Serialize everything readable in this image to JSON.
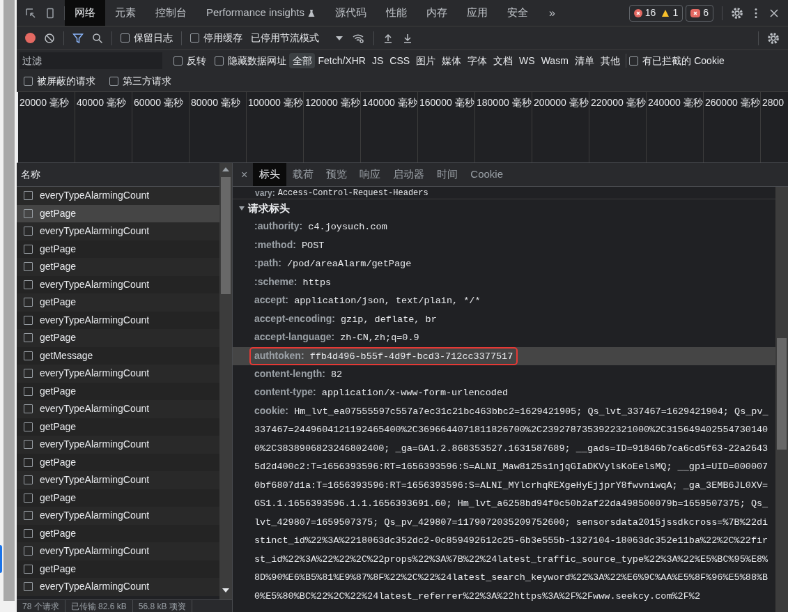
{
  "main_tabs": [
    {
      "label": "网络",
      "selected": true
    },
    {
      "label": "元素",
      "selected": false
    },
    {
      "label": "控制台",
      "selected": false
    },
    {
      "label": "Performance insights",
      "selected": false,
      "flask": true
    },
    {
      "label": "源代码",
      "selected": false
    },
    {
      "label": "性能",
      "selected": false
    },
    {
      "label": "内存",
      "selected": false
    },
    {
      "label": "应用",
      "selected": false
    },
    {
      "label": "安全",
      "selected": false
    }
  ],
  "more_tabs": "»",
  "counters": {
    "errors": "16",
    "warnings": "1",
    "issues": "6"
  },
  "toolbar": {
    "preserve_log": {
      "label": "保留日志",
      "checked": false
    },
    "disable_cache": {
      "label": "停用缓存",
      "checked": false
    },
    "throttling": "已停用节流模式",
    "recording": true
  },
  "filter": {
    "placeholder": "过滤",
    "invert": {
      "label": "反转",
      "checked": false
    },
    "hide_data_urls": {
      "label": "隐藏数据网址",
      "checked": false
    },
    "types": [
      {
        "label": "全部",
        "selected": true
      },
      {
        "label": "Fetch/XHR",
        "selected": false
      },
      {
        "label": "JS",
        "selected": false
      },
      {
        "label": "CSS",
        "selected": false
      },
      {
        "label": "图片",
        "selected": false
      },
      {
        "label": "媒体",
        "selected": false
      },
      {
        "label": "字体",
        "selected": false
      },
      {
        "label": "文档",
        "selected": false
      },
      {
        "label": "WS",
        "selected": false
      },
      {
        "label": "Wasm",
        "selected": false
      },
      {
        "label": "清单",
        "selected": false
      },
      {
        "label": "其他",
        "selected": false
      }
    ],
    "blocked_cookies": {
      "label": "有已拦截的 Cookie",
      "checked": false
    },
    "blocked_requests": {
      "label": "被屏蔽的请求",
      "checked": false
    },
    "third_party": {
      "label": "第三方请求",
      "checked": false
    }
  },
  "timeline": {
    "ticks": [
      "20000 毫秒",
      "40000 毫秒",
      "60000 毫秒",
      "80000 毫秒",
      "100000 毫秒",
      "120000 毫秒",
      "140000 毫秒",
      "160000 毫秒",
      "180000 毫秒",
      "200000 毫秒",
      "220000 毫秒",
      "240000 毫秒",
      "260000 毫秒",
      "2800"
    ]
  },
  "requests": {
    "column": "名称",
    "rows": [
      {
        "name": "everyTypeAlarmingCount",
        "selected": false
      },
      {
        "name": "getPage",
        "selected": true
      },
      {
        "name": "everyTypeAlarmingCount",
        "selected": false
      },
      {
        "name": "getPage",
        "selected": false
      },
      {
        "name": "getPage",
        "selected": false
      },
      {
        "name": "everyTypeAlarmingCount",
        "selected": false
      },
      {
        "name": "getPage",
        "selected": false
      },
      {
        "name": "everyTypeAlarmingCount",
        "selected": false
      },
      {
        "name": "getPage",
        "selected": false
      },
      {
        "name": "getMessage",
        "selected": false
      },
      {
        "name": "everyTypeAlarmingCount",
        "selected": false
      },
      {
        "name": "getPage",
        "selected": false
      },
      {
        "name": "everyTypeAlarmingCount",
        "selected": false
      },
      {
        "name": "getPage",
        "selected": false
      },
      {
        "name": "everyTypeAlarmingCount",
        "selected": false
      },
      {
        "name": "getPage",
        "selected": false
      },
      {
        "name": "everyTypeAlarmingCount",
        "selected": false
      },
      {
        "name": "getPage",
        "selected": false
      },
      {
        "name": "everyTypeAlarmingCount",
        "selected": false
      },
      {
        "name": "getPage",
        "selected": false
      },
      {
        "name": "everyTypeAlarmingCount",
        "selected": false
      },
      {
        "name": "getPage",
        "selected": false
      },
      {
        "name": "everyTypeAlarmingCount",
        "selected": false
      }
    ]
  },
  "status_bar": [
    "78 个请求",
    "已传输 82.6 kB",
    "56.8 kB 项资"
  ],
  "detail_tabs": {
    "close": "×",
    "tabs": [
      {
        "label": "标头",
        "selected": true
      },
      {
        "label": "载荷",
        "selected": false
      },
      {
        "label": "预览",
        "selected": false
      },
      {
        "label": "响应",
        "selected": false
      },
      {
        "label": "启动器",
        "selected": false
      },
      {
        "label": "时间",
        "selected": false
      },
      {
        "label": "Cookie",
        "selected": false
      }
    ]
  },
  "headers": {
    "partial_row": {
      "name": "vary:",
      "value": "Access-Control-Request-Headers"
    },
    "section": {
      "title": "请求标头",
      "expanded": true
    },
    "rows": [
      {
        "name": ":authority:",
        "value": "c4.joysuch.com",
        "highlighted": false
      },
      {
        "name": ":method:",
        "value": "POST",
        "highlighted": false
      },
      {
        "name": ":path:",
        "value": "/pod/areaAlarm/getPage",
        "highlighted": false
      },
      {
        "name": ":scheme:",
        "value": "https",
        "highlighted": false
      },
      {
        "name": "accept:",
        "value": "application/json, text/plain, */*",
        "highlighted": false
      },
      {
        "name": "accept-encoding:",
        "value": "gzip, deflate, br",
        "highlighted": false
      },
      {
        "name": "accept-language:",
        "value": "zh-CN,zh;q=0.9",
        "highlighted": false
      },
      {
        "name": "authtoken:",
        "value": "ffb4d496-b55f-4d9f-bcd3-712cc3377517",
        "highlighted": true
      },
      {
        "name": "content-length:",
        "value": "82",
        "highlighted": false
      },
      {
        "name": "content-type:",
        "value": "application/x-www-form-urlencoded",
        "highlighted": false
      },
      {
        "name": "cookie:",
        "value": "Hm_lvt_ea07555597c557a7ec31c21bc463bbc2=1629421905; Qs_lvt_337467=1629421904; Qs_pv_337467=2449604121192465400%2C3696644071811826700%2C2392787353922321000%2C3156494025547301400%2C3838906823246802400; _ga=GA1.2.868353527.1631587689; __gads=ID=91846b7ca6cd5f63-22a26435d2d400c2:T=1656393596:RT=1656393596:S=ALNI_Maw8i25s1njqGIaDKVylsKoEelsMQ; __gpi=UID=0000070bf6807d1a:T=1656393596:RT=1656393596:S=ALNI_MYlcrhqREXgeHyEjjprY8fwvniwqA; _ga_3EMB6JL0XV=GS1.1.1656393596.1.1.1656393691.60; Hm_lvt_a6258bd94f0c50b2af22da498500079b=1659507375; Qs_lvt_429807=1659507375; Qs_pv_429807=1179072035209752600; sensorsdata2015jssdkcross=%7B%22distinct_id%22%3A%2218063dc352dc2-0c859492612c25-6b3e555b-1327104-18063dc352e11ba%22%2C%22first_id%22%3A%22%22%2C%22props%22%3A%7B%22%24latest_traffic_source_type%22%3A%22%E5%BC%95%E8%8D%90%E6%B5%81%E9%87%8F%22%2C%22%24latest_search_keyword%22%3A%22%E6%9C%AA%E5%8F%96%E5%88%B0%E5%80%BC%22%2C%22%24latest_referrer%22%3A%22https%3A%2F%2Fwww.seekcy.com%2F%2",
        "highlighted": false
      }
    ]
  }
}
